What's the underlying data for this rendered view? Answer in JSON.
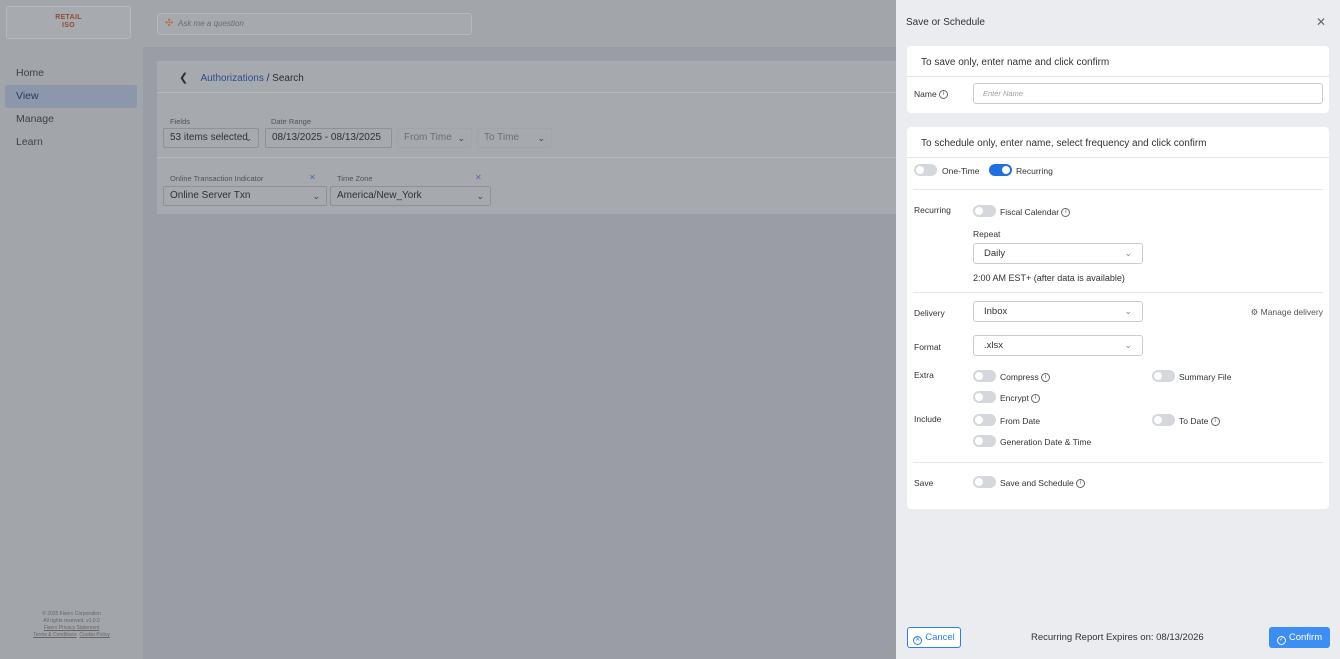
{
  "app": {
    "logo_line1": "RETAIL",
    "logo_line2": "ISO",
    "ask_placeholder": "Ask me a question",
    "nav": [
      "Home",
      "View",
      "Manage",
      "Learn"
    ],
    "footer": {
      "line1": "© 2025 Fiserv Corporation",
      "line2": "All rights reserved. v1.0.0",
      "line3": "Fiserv Privacy Statement",
      "terms": "Terms & Conditions",
      "cookie": "Cookie Policy"
    }
  },
  "search_panel": {
    "breadcrumb_link": "Authorizations",
    "breadcrumb_current": " / Search",
    "fields_label": "Fields",
    "fields_value": "53 items selected",
    "date_range_label": "Date Range",
    "date_range_value": "08/13/2025 - 08/13/2025",
    "from_time": "From Time",
    "to_time": "To Time",
    "oti_label": "Online Transaction Indicator",
    "oti_value": "Online Server Txn",
    "tz_label": "Time Zone",
    "tz_value": "America/New_York"
  },
  "modal": {
    "title": "Save or Schedule",
    "save_section": {
      "heading": "To save only, enter name and click confirm",
      "name_label": "Name",
      "name_placeholder": "Enter Name"
    },
    "schedule_section": {
      "heading": "To schedule only, enter name, select frequency and click confirm",
      "one_time": "One-Time",
      "recurring": "Recurring",
      "recurring_label": "Recurring",
      "fiscal_calendar": "Fiscal Calendar",
      "repeat_label": "Repeat",
      "repeat_value": "Daily",
      "schedule_note": "2:00 AM EST+ (after data is available)",
      "delivery_label": "Delivery",
      "delivery_value": "Inbox",
      "manage_delivery": "Manage delivery",
      "format_label": "Format",
      "format_value": ".xlsx",
      "extra_label": "Extra",
      "compress": "Compress",
      "summary_file": "Summary File",
      "encrypt": "Encrypt",
      "include_label": "Include",
      "from_date": "From Date",
      "to_date": "To Date",
      "generation_date": "Generation Date & Time",
      "save_label": "Save",
      "save_and_schedule": "Save and Schedule"
    },
    "toggles": {
      "one_time": false,
      "recurring": true,
      "fiscal_calendar": false,
      "compress": false,
      "summary_file": false,
      "encrypt": false,
      "from_date": false,
      "to_date": false,
      "generation_date": false,
      "save_and_schedule": false
    },
    "footer": {
      "cancel": "Cancel",
      "expires": "Recurring Report Expires on: 08/13/2026",
      "confirm": "Confirm"
    }
  },
  "colors": {
    "accent": "#1f6fde",
    "confirm_bg": "#3d8ef2",
    "overlay": "#9a9ea4"
  }
}
